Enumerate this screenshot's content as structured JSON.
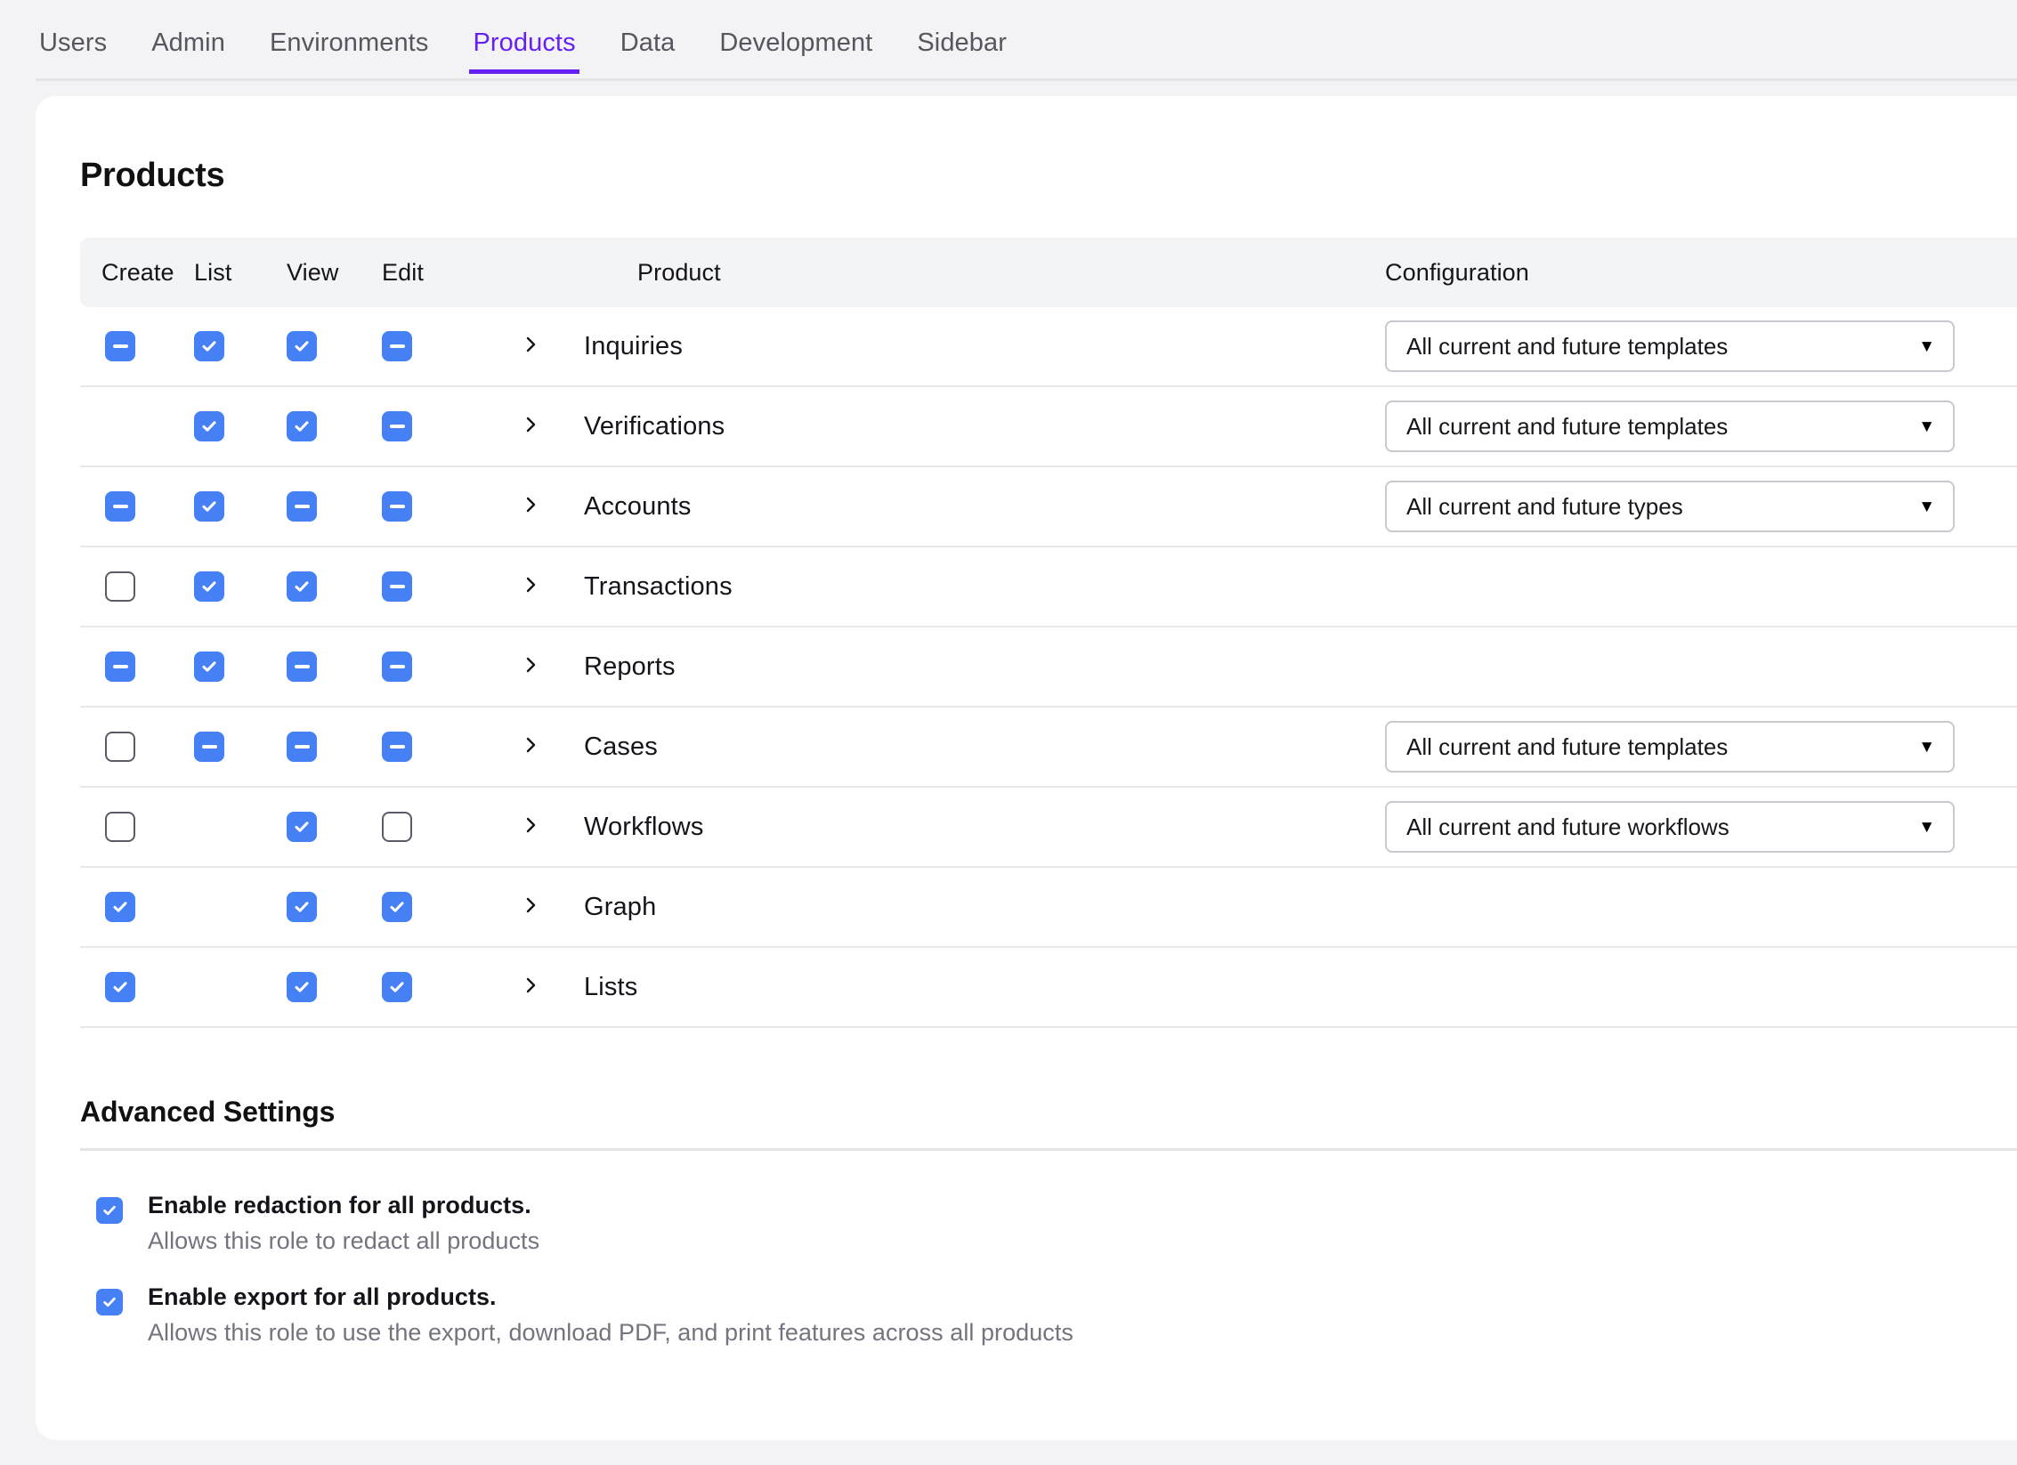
{
  "nav": {
    "tabs": [
      {
        "label": "Users",
        "active": false
      },
      {
        "label": "Admin",
        "active": false
      },
      {
        "label": "Environments",
        "active": false
      },
      {
        "label": "Products",
        "active": true
      },
      {
        "label": "Data",
        "active": false
      },
      {
        "label": "Development",
        "active": false
      },
      {
        "label": "Sidebar",
        "active": false
      }
    ],
    "accent_color": "#6520f5"
  },
  "page": {
    "title": "Products"
  },
  "table": {
    "columns": [
      "Create",
      "List",
      "View",
      "Edit",
      "Product",
      "Configuration"
    ],
    "rows": [
      {
        "product": "Inquiries",
        "create": "indeterminate",
        "list": "checked",
        "view": "checked",
        "edit": "indeterminate",
        "config": "All current and future templates"
      },
      {
        "product": "Verifications",
        "create": "none",
        "list": "checked",
        "view": "checked",
        "edit": "indeterminate",
        "config": "All current and future templates"
      },
      {
        "product": "Accounts",
        "create": "indeterminate",
        "list": "checked",
        "view": "indeterminate",
        "edit": "indeterminate",
        "config": "All current and future types"
      },
      {
        "product": "Transactions",
        "create": "unchecked",
        "list": "checked",
        "view": "checked",
        "edit": "indeterminate",
        "config": ""
      },
      {
        "product": "Reports",
        "create": "indeterminate",
        "list": "checked",
        "view": "indeterminate",
        "edit": "indeterminate",
        "config": ""
      },
      {
        "product": "Cases",
        "create": "unchecked",
        "list": "indeterminate",
        "view": "indeterminate",
        "edit": "indeterminate",
        "config": "All current and future templates"
      },
      {
        "product": "Workflows",
        "create": "unchecked",
        "list": "none",
        "view": "checked",
        "edit": "unchecked",
        "config": "All current and future workflows"
      },
      {
        "product": "Graph",
        "create": "checked",
        "list": "none",
        "view": "checked",
        "edit": "checked",
        "config": ""
      },
      {
        "product": "Lists",
        "create": "checked",
        "list": "none",
        "view": "checked",
        "edit": "checked",
        "config": ""
      }
    ],
    "checkbox_color": "#4680f5"
  },
  "advanced": {
    "title": "Advanced Settings",
    "items": [
      {
        "label": "Enable redaction for all products.",
        "description": "Allows this role to redact all products",
        "state": "checked"
      },
      {
        "label": "Enable export for all products.",
        "description": "Allows this role to use the export, download PDF, and print features across all products",
        "state": "checked"
      }
    ]
  }
}
